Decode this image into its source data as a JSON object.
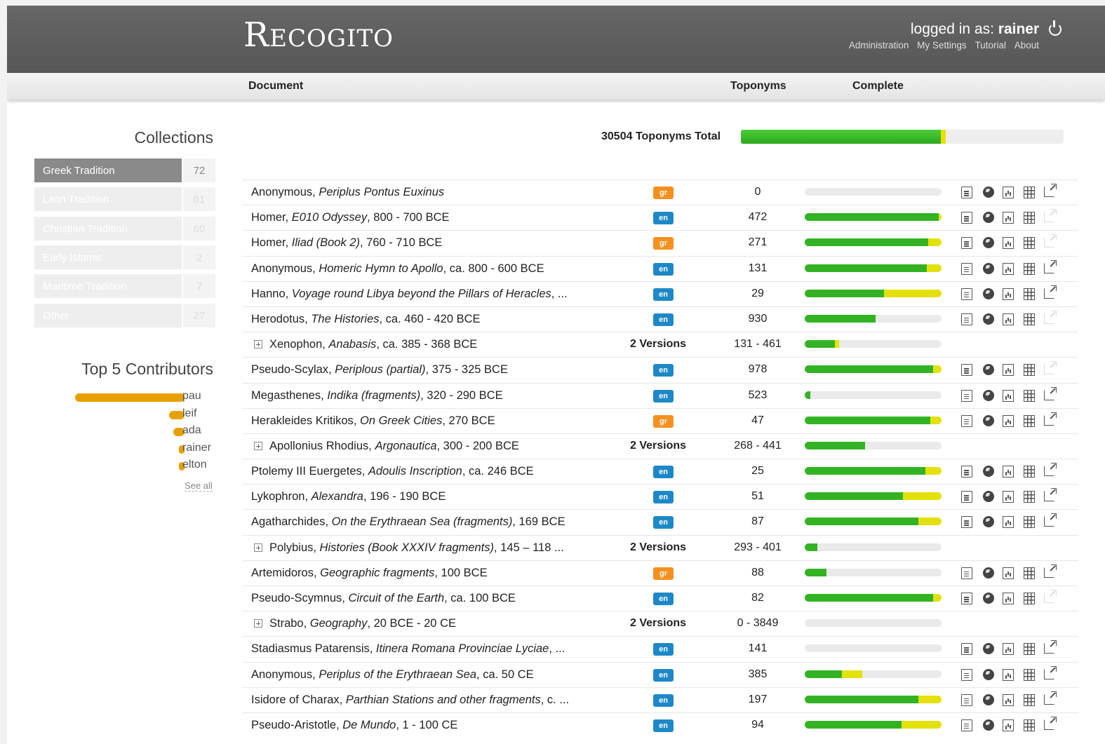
{
  "header": {
    "logo": "Recogito",
    "logged_in_label": "logged in as:",
    "username": "rainer",
    "links": [
      "Administration",
      "My Settings",
      "Tutorial",
      "About"
    ]
  },
  "columns": {
    "document": "Document",
    "toponyms": "Toponyms",
    "complete": "Complete"
  },
  "sidebar": {
    "collections_title": "Collections",
    "collections": [
      {
        "name": "Greek Tradition",
        "count": "72",
        "active": true
      },
      {
        "name": "Latin Tradition",
        "count": "61"
      },
      {
        "name": "Christian Tradition",
        "count": "60"
      },
      {
        "name": "Early Islamic",
        "count": "2"
      },
      {
        "name": "Maritime Tradition",
        "count": "7"
      },
      {
        "name": "Other",
        "count": "27"
      }
    ],
    "contributors_title": "Top 5 Contributors",
    "contributors": [
      {
        "name": "pau",
        "share": 1.0
      },
      {
        "name": "leif",
        "share": 0.14
      },
      {
        "name": "ada",
        "share": 0.1
      },
      {
        "name": "rainer",
        "share": 0.05
      },
      {
        "name": "elton",
        "share": 0.05
      }
    ],
    "see_all": "See all"
  },
  "total": {
    "label": "30504 Toponyms Total",
    "green": 0.62,
    "yellow": 0.015
  },
  "documents": [
    {
      "author": "Anonymous",
      "title": "Periplus Pontus Euxinus",
      "suffix": "",
      "lang": "gr",
      "toponyms": "0",
      "green": 0,
      "yellow": 0,
      "ext": true
    },
    {
      "author": "Homer",
      "title": "E010 Odyssey",
      "suffix": ", 800 - 700 BCE",
      "lang": "en",
      "toponyms": "472",
      "green": 0.98,
      "yellow": 0.02,
      "ext": false
    },
    {
      "author": "Homer",
      "title": "Iliad (Book 2)",
      "suffix": ", 760 - 710 BCE",
      "lang": "gr",
      "toponyms": "271",
      "green": 0.9,
      "yellow": 0.1,
      "ext": false
    },
    {
      "author": "Anonymous",
      "title": "Homeric Hymn to Apollo",
      "suffix": ", ca. 800 - 600 BCE",
      "lang": "en",
      "toponyms": "131",
      "green": 0.89,
      "yellow": 0.11,
      "ext": true
    },
    {
      "author": "Hanno",
      "title": "Voyage round Libya beyond the Pillars of Heracles",
      "suffix": ", ...",
      "lang": "en",
      "toponyms": "29",
      "green": 0.58,
      "yellow": 0.42,
      "ext": true
    },
    {
      "author": "Herodotus",
      "title": "The Histories",
      "suffix": ", ca. 460 - 420 BCE",
      "lang": "en",
      "toponyms": "930",
      "green": 0.52,
      "yellow": 0,
      "ext": false
    },
    {
      "author": "Xenophon",
      "title": "Anabasis",
      "suffix": ", ca. 385 - 368 BCE",
      "versions": "2 Versions",
      "toponyms": "131 - 461",
      "green": 0.22,
      "yellow": 0.03
    },
    {
      "author": "Pseudo-Scylax",
      "title": "Periplous (partial)",
      "suffix": ", 375 - 325 BCE",
      "lang": "en",
      "toponyms": "978",
      "green": 0.94,
      "yellow": 0.06,
      "ext": false
    },
    {
      "author": "Megasthenes",
      "title": "Indika (fragments)",
      "suffix": ", 320 - 290 BCE",
      "lang": "en",
      "toponyms": "523",
      "green": 0.04,
      "yellow": 0,
      "ext": true
    },
    {
      "author": "Herakleides Kritikos",
      "title": "On Greek Cities",
      "suffix": ", 270 BCE",
      "lang": "gr",
      "toponyms": "47",
      "green": 0.92,
      "yellow": 0.08,
      "ext": true
    },
    {
      "author": "Apollonius Rhodius",
      "title": "Argonautica",
      "suffix": ", 300 - 200 BCE",
      "versions": "2 Versions",
      "toponyms": "268 - 441",
      "green": 0.44,
      "yellow": 0
    },
    {
      "author": "Ptolemy III Euergetes",
      "title": "Adoulis Inscription",
      "suffix": ", ca. 246 BCE",
      "lang": "en",
      "toponyms": "25",
      "green": 0.88,
      "yellow": 0.12,
      "ext": true
    },
    {
      "author": "Lykophron",
      "title": "Alexandra",
      "suffix": ", 196 - 190 BCE",
      "lang": "en",
      "toponyms": "51",
      "green": 0.72,
      "yellow": 0.28,
      "ext": true
    },
    {
      "author": "Agatharchides",
      "title": "On the Erythraean Sea (fragments)",
      "suffix": ", 169 BCE",
      "lang": "en",
      "toponyms": "87",
      "green": 0.83,
      "yellow": 0.17,
      "ext": true
    },
    {
      "author": "Polybius",
      "title": "Histories (Book XXXIV fragments)",
      "suffix": ", 145 – 118 ...",
      "versions": "2 Versions",
      "toponyms": "293 - 401",
      "green": 0.09,
      "yellow": 0
    },
    {
      "author": "Artemidoros",
      "title": "Geographic fragments",
      "suffix": ", 100 BCE",
      "lang": "gr",
      "toponyms": "88",
      "green": 0.16,
      "yellow": 0,
      "ext": true
    },
    {
      "author": "Pseudo-Scymnus",
      "title": "Circuit of the Earth",
      "suffix": ", ca. 100 BCE",
      "lang": "en",
      "toponyms": "82",
      "green": 0.94,
      "yellow": 0.06,
      "ext": false
    },
    {
      "author": "Strabo",
      "title": "Geography",
      "suffix": ", 20 BCE - 20 CE",
      "versions": "2 Versions",
      "toponyms": "0 - 3849",
      "green": 0,
      "yellow": 0
    },
    {
      "author": "Stadiasmus Patarensis",
      "title": "Itinera Romana Provinciae Lyciae",
      "suffix": ", ...",
      "lang": "en",
      "toponyms": "141",
      "green": 0,
      "yellow": 0,
      "ext": true
    },
    {
      "author": "Anonymous",
      "title": "Periplus of the Erythraean Sea",
      "suffix": ", ca. 50 CE",
      "lang": "en",
      "toponyms": "385",
      "green": 0.27,
      "yellow": 0.15,
      "ext": true
    },
    {
      "author": "Isidore of Charax",
      "title": "Parthian Stations and other fragments",
      "suffix": ", c. ...",
      "lang": "en",
      "toponyms": "197",
      "green": 0.83,
      "yellow": 0.17,
      "ext": true
    },
    {
      "author": "Pseudo-Aristotle",
      "title": "De Mundo",
      "suffix": ", 1 - 100 CE",
      "lang": "en",
      "toponyms": "94",
      "green": 0.71,
      "yellow": 0.29,
      "ext": true
    }
  ]
}
